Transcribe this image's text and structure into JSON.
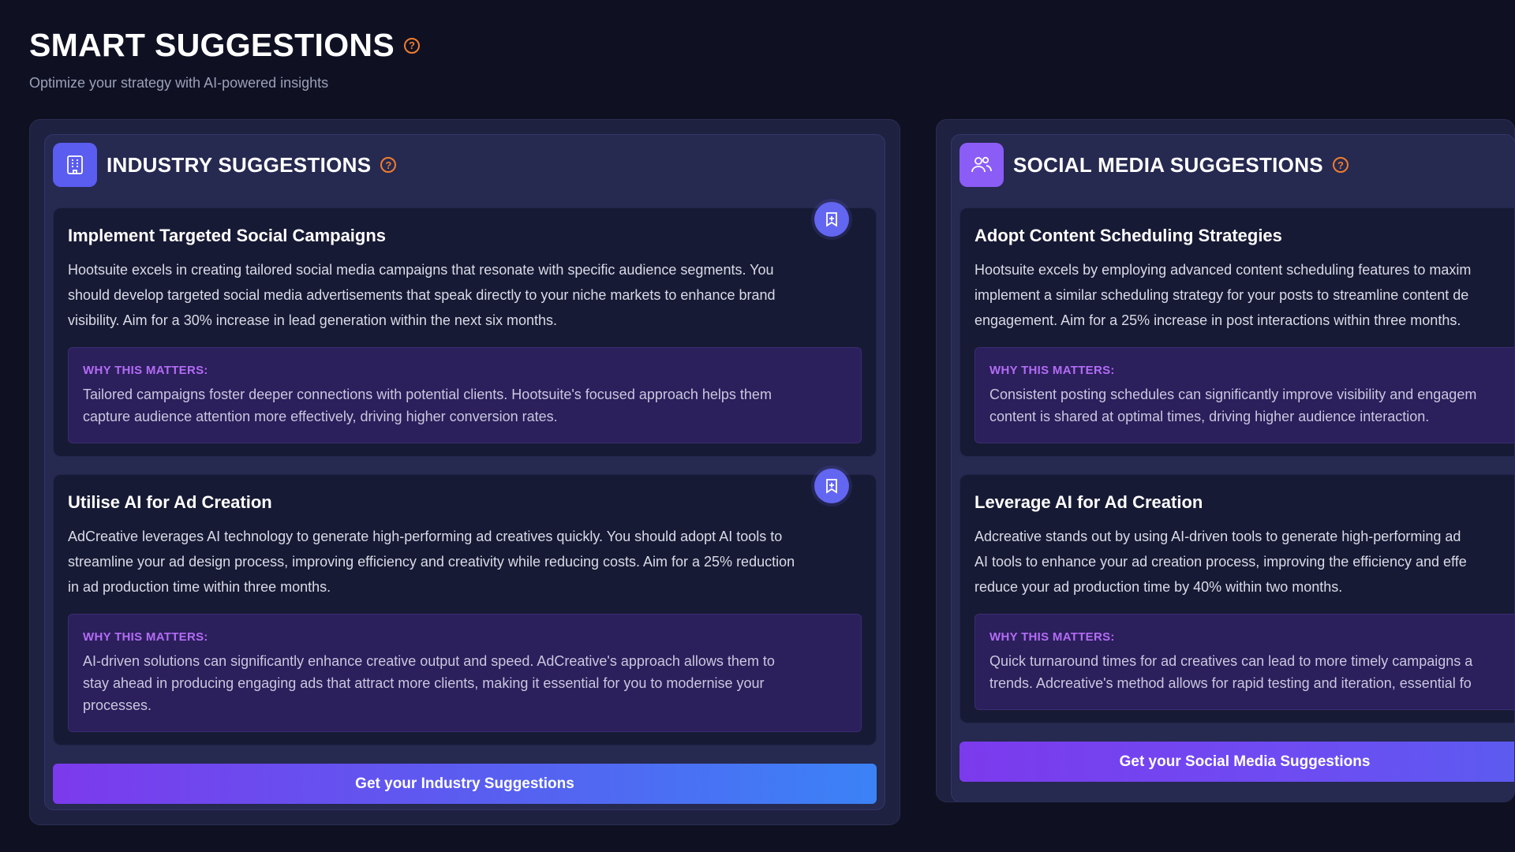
{
  "header": {
    "title": "SMART SUGGESTIONS",
    "subtitle": "Optimize your strategy with AI-powered insights"
  },
  "help_icon_glyph": "?",
  "colors": {
    "background": "#0f1123",
    "accent_orange": "#f07d2e",
    "accent_purple": "#b36cf5",
    "button_gradient_start": "#7c3aed",
    "button_gradient_end": "#3b82f6"
  },
  "industry": {
    "title": "INDUSTRY SUGGESTIONS",
    "icon": "building-icon",
    "cards": [
      {
        "title": "Implement Targeted Social Campaigns",
        "body_lines": [
          "Hootsuite excels in creating tailored social media campaigns that resonate with specific audience segments. You",
          "should develop targeted social media advertisements that speak directly to your niche markets to enhance brand",
          "visibility. Aim for a 30% increase in lead generation within the next six months."
        ],
        "why_label": "WHY THIS MATTERS:",
        "why_lines": [
          "Tailored campaigns foster deeper connections with potential clients. Hootsuite's focused approach helps them",
          "capture audience attention more effectively, driving higher conversion rates."
        ]
      },
      {
        "title": "Utilise AI for Ad Creation",
        "body_lines": [
          "AdCreative leverages AI technology to generate high-performing ad creatives quickly. You should adopt AI tools to",
          "streamline your ad design process, improving efficiency and creativity while reducing costs. Aim for a 25% reduction",
          "in ad production time within three months."
        ],
        "why_label": "WHY THIS MATTERS:",
        "why_lines": [
          "AI-driven solutions can significantly enhance creative output and speed. AdCreative's approach allows them to",
          "stay ahead in producing engaging ads that attract more clients, making it essential for you to modernise your",
          "processes."
        ]
      }
    ],
    "cta_label": "Get your Industry Suggestions"
  },
  "social": {
    "title": "SOCIAL MEDIA SUGGESTIONS",
    "icon": "users-icon",
    "cards": [
      {
        "title": "Adopt Content Scheduling Strategies",
        "body_lines": [
          "Hootsuite excels by employing advanced content scheduling features to maxim",
          "implement a similar scheduling strategy for your posts to streamline content de",
          "engagement. Aim for a 25% increase in post interactions within three months."
        ],
        "why_label": "WHY THIS MATTERS:",
        "why_lines": [
          "Consistent posting schedules can significantly improve visibility and engagem",
          "content is shared at optimal times, driving higher audience interaction."
        ]
      },
      {
        "title": "Leverage AI for Ad Creation",
        "body_lines": [
          "Adcreative stands out by using AI-driven tools to generate high-performing ad",
          "AI tools to enhance your ad creation process, improving the efficiency and effe",
          "reduce your ad production time by 40% within two months."
        ],
        "why_label": "WHY THIS MATTERS:",
        "why_lines": [
          "Quick turnaround times for ad creatives can lead to more timely campaigns a",
          "trends. Adcreative's method allows for rapid testing and iteration, essential fo"
        ]
      }
    ],
    "cta_label": "Get your Social Media Suggestions"
  }
}
